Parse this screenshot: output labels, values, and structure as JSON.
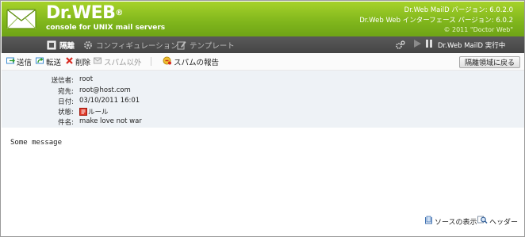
{
  "header": {
    "brand": "Dr.WEB",
    "brand_mark": "®",
    "subtitle": "console for UNIX mail servers",
    "version_maild": "Dr.Web MailD バージョン:  6.0.2.0",
    "version_ui": "Dr.Web Web インターフェース バージョン:   6.0.2",
    "copyright": "© 2011 \"Doctor Web\""
  },
  "nav": {
    "items": [
      {
        "label": "隔離",
        "icon": "quarantine-icon",
        "active": true
      },
      {
        "label": "コンフィギュレーション",
        "icon": "gear-icon",
        "active": false
      },
      {
        "label": "テンプレート",
        "icon": "edit-icon",
        "active": false
      }
    ],
    "status_label": "Dr.Web MailD 実行中"
  },
  "toolbar": {
    "send": "送信",
    "forward": "転送",
    "delete": "削除",
    "except_spam": "スパム以外",
    "report_spam": "スパムの報告",
    "restore": "隔離領域に戻る"
  },
  "info": {
    "rows": [
      {
        "label": "送信者:",
        "value": "root"
      },
      {
        "label": "宛先:",
        "value": "root@host.com"
      },
      {
        "label": "日付:",
        "value": "03/10/2011 16:01"
      },
      {
        "label": "状態:",
        "value": "ルール"
      },
      {
        "label": "件名:",
        "value": "make love not war"
      }
    ]
  },
  "message": {
    "body": "Some message"
  },
  "footer": {
    "view_source": "ソースの表示",
    "headers": "ヘッダー"
  },
  "colors": {
    "brand_green": "#8cc21f",
    "nav_dark": "#4f4f4f",
    "info_bg": "#eef2f6"
  }
}
